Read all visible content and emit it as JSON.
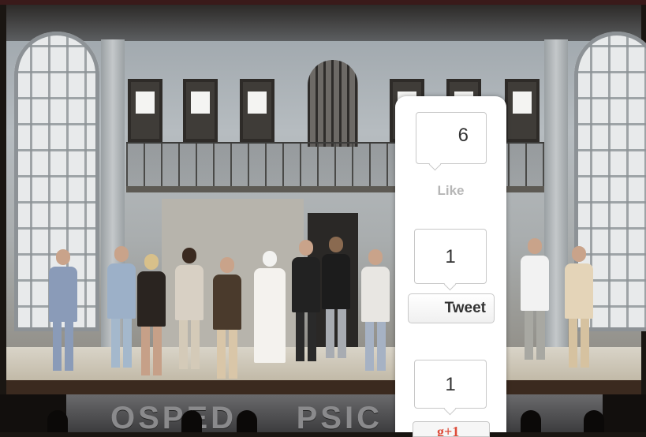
{
  "background": {
    "banner_text": "OSPED     PSIC"
  },
  "share": {
    "facebook": {
      "count": "6",
      "label": "Like"
    },
    "twitter": {
      "count": "1",
      "label": "Tweet"
    },
    "gplus": {
      "count": "1",
      "label": "g+1"
    }
  },
  "colors": {
    "panel_bg": "#ffffff",
    "gplus_red": "#dd4b39",
    "muted_label": "#b6b6b6"
  }
}
